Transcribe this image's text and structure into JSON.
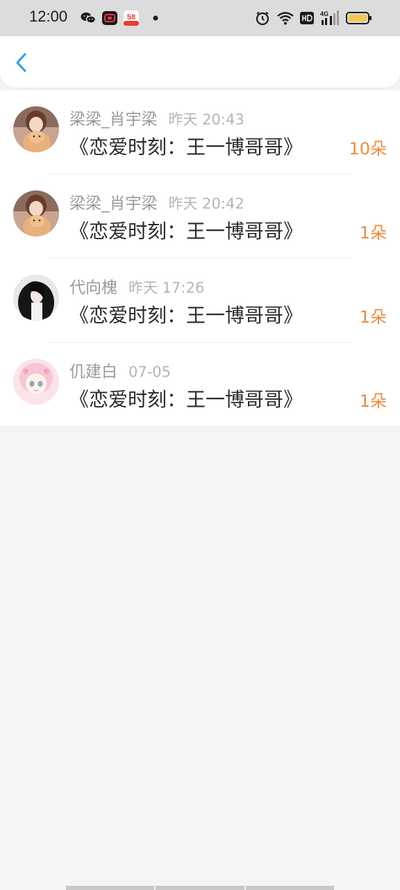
{
  "status_bar": {
    "time": "12:00",
    "left_icons": [
      "wechat-icon",
      "video-app-icon",
      "app-58-icon",
      "notification-dot-icon"
    ],
    "right_icons": [
      "alarm-icon",
      "wifi-icon",
      "hd-icon",
      "signal-4g-icon",
      "battery-icon"
    ],
    "app_58_label": "58"
  },
  "header": {
    "back_icon": "chevron-left-icon",
    "accent_color": "#2a9fe0"
  },
  "list": {
    "items": [
      {
        "name": "梁梁_肖宇梁",
        "time": "昨天 20:43",
        "content": "《恋爱时刻：王一博哥哥》",
        "count": "10朵"
      },
      {
        "name": "梁梁_肖宇梁",
        "time": "昨天 20:42",
        "content": "《恋爱时刻：王一博哥哥》",
        "count": "1朵"
      },
      {
        "name": "代向槐",
        "time": "昨天 17:26",
        "content": "《恋爱时刻：王一博哥哥》",
        "count": "1朵"
      },
      {
        "name": "仉建白",
        "time": "07-05",
        "content": "《恋爱时刻：王一博哥哥》",
        "count": "1朵"
      }
    ]
  },
  "colors": {
    "count_orange": "#ef8a3a",
    "name_gray": "#9a9a9a",
    "page_bg": "#f6f4f5"
  }
}
